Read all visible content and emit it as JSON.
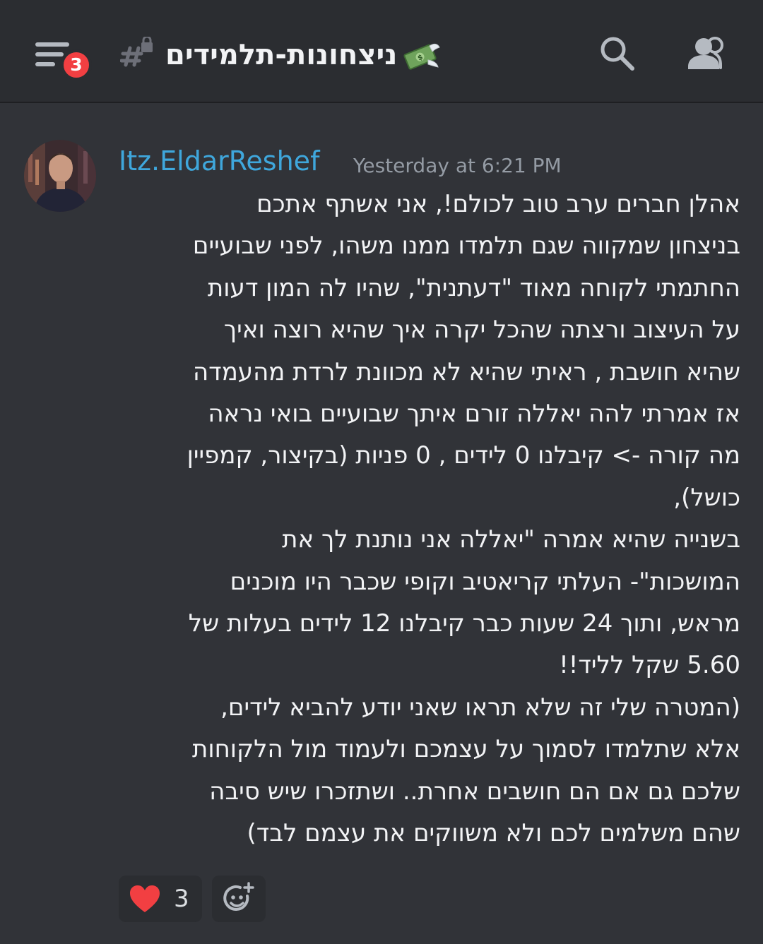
{
  "header": {
    "unread_badge": "3",
    "channel_name": "ניצחונות-תלמידים",
    "icons": {
      "menu": "hamburger-menu-icon",
      "channel": "locked-channel-hash-icon",
      "channel_emoji": "money-with-wings-icon",
      "search": "search-icon",
      "members": "members-icon"
    }
  },
  "message": {
    "username": "Itz.EldarReshef",
    "timestamp": "Yesterday at 6:21 PM",
    "lines": [
      "אהלן חברים ערב טוב לכולם!, אני אשתף אתכם",
      "בניצחון שמקווה שגם תלמדו ממנו משהו, לפני שבועיים",
      "החתמתי לקוחה מאוד \"דעתנית\", שהיו לה המון דעות",
      "על העיצוב ורצתה שהכל יקרה איך שהיא רוצה ואיך",
      "שהיא חושבת , ראיתי שהיא לא מכוונת לרדת מהעמדה",
      "אז אמרתי להה יאללה זורם איתך שבועיים בואי נראה",
      "מה קורה -> קיבלנו 0 לידים , 0 פניות (בקיצור, קמפיין",
      "כושל),",
      "בשנייה שהיא אמרה \"יאללה אני נותנת לך את",
      "המושכות\"- העלתי קריאטיב וקופי שכבר היו מוכנים",
      "מראש, ותוך 24 שעות כבר קיבלנו 12 לידים בעלות של",
      "5.60 שקל לליד!!",
      "(המטרה שלי זה שלא תראו שאני יודע להביא לידים,",
      "אלא שתלמדו לסמוך על עצמכם ולעמוד מול הלקוחות",
      "שלכם גם אם הם חושבים אחרת.. ושתזכרו שיש סיבה",
      "שהם משלמים לכם ולא משווקים את עצמם לבד)"
    ],
    "reactions": {
      "heart_emoji": "red-heart-icon",
      "heart_count": "3",
      "add_reaction_icon": "add-reaction-icon"
    }
  },
  "colors": {
    "background": "#313338",
    "header_background": "#2b2d31",
    "username": "#3fa7dc",
    "timestamp": "#949ba4",
    "badge": "#f23f42",
    "heart": "#f23f42"
  }
}
